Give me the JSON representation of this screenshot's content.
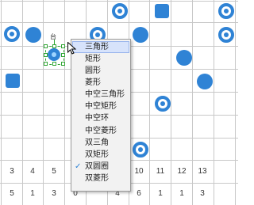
{
  "colors": {
    "token": "#2f83d5",
    "grid": "#c8c8c8",
    "selection": "#31a634",
    "menu_bg": "#f2f2f2",
    "menu_highlight": "#d7e3fb"
  },
  "selected_shape": {
    "label": "台",
    "shape": "circle"
  },
  "row_top": [
    "3",
    "4",
    "5",
    "",
    "",
    "9",
    "10",
    "11",
    "12",
    "13"
  ],
  "row_bottom": [
    "5",
    "1",
    "3",
    "0",
    "",
    "4",
    "6",
    "1",
    "1",
    "3"
  ],
  "menu": {
    "items": [
      {
        "label": "三角形",
        "highlighted": true,
        "checked": false
      },
      {
        "label": "矩形",
        "highlighted": false,
        "checked": false
      },
      {
        "label": "圆形",
        "highlighted": false,
        "checked": false
      },
      {
        "label": "菱形",
        "highlighted": false,
        "checked": false
      },
      {
        "label": "中空三角形",
        "highlighted": false,
        "checked": false
      },
      {
        "label": "中空矩形",
        "highlighted": false,
        "checked": false
      },
      {
        "label": "中空环",
        "highlighted": false,
        "checked": false
      },
      {
        "label": "中空菱形",
        "highlighted": false,
        "checked": false
      },
      {
        "label": "双三角",
        "highlighted": false,
        "checked": false
      },
      {
        "label": "双矩形",
        "highlighted": false,
        "checked": false
      },
      {
        "label": "双圆圈",
        "highlighted": false,
        "checked": true
      },
      {
        "label": "双菱形",
        "highlighted": false,
        "checked": false
      }
    ]
  }
}
